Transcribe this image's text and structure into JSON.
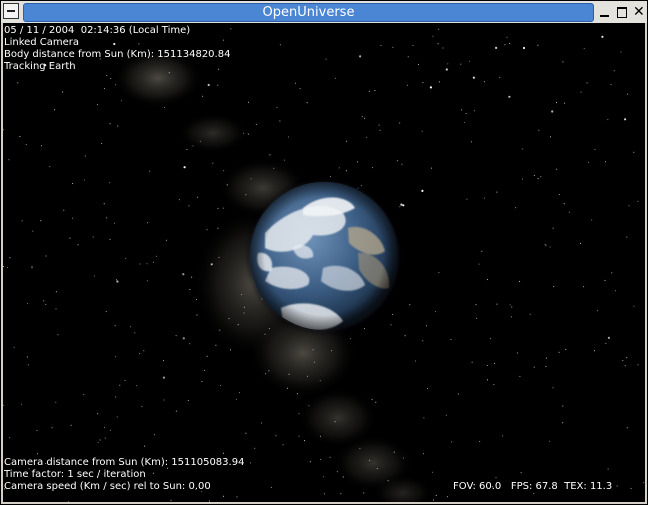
{
  "window": {
    "title": "OpenUniverse"
  },
  "hud_top": {
    "datetime": "05 / 11 / 2004  02:14:36 (Local Time)",
    "camera_mode": "Linked Camera",
    "body_distance": "Body distance from Sun (Km): 151134820.84",
    "tracking": "Tracking Earth"
  },
  "hud_bottom": {
    "camera_distance": "Camera distance from Sun (Km): 151105083.94",
    "time_factor": "Time factor: 1 sec / iteration",
    "camera_speed": "Camera speed (Km / sec) rel to Sun: 0.00"
  },
  "hud_stats": {
    "stats": "FOV: 60.0   FPS: 67.8  TEX: 11.3"
  },
  "colors": {
    "titlebar_accent": "#4a86d4",
    "space": "#000000",
    "hud_text": "#ffffff"
  },
  "icons": [
    "system-menu-icon",
    "minimize-icon",
    "maximize-icon",
    "close-icon"
  ]
}
